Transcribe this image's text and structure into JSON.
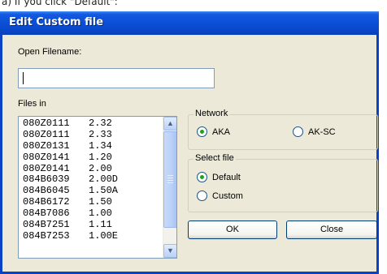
{
  "caption": "a) If you click \"Default\":",
  "window": {
    "title": "Edit Custom file"
  },
  "open_filename": {
    "label": "Open Filename:",
    "value": ""
  },
  "files": {
    "label": "Files in",
    "items": [
      {
        "name": "080Z0111",
        "version": "2.32"
      },
      {
        "name": "080Z0111",
        "version": "2.33"
      },
      {
        "name": "080Z0131",
        "version": "1.34"
      },
      {
        "name": "080Z0141",
        "version": "1.20"
      },
      {
        "name": "080Z0141",
        "version": "2.00"
      },
      {
        "name": "084B6039",
        "version": "2.00D"
      },
      {
        "name": "084B6045",
        "version": "1.50A"
      },
      {
        "name": "084B6172",
        "version": "1.50"
      },
      {
        "name": "084B7086",
        "version": "1.00"
      },
      {
        "name": "084B7251",
        "version": "1.11"
      },
      {
        "name": "084B7253",
        "version": "1.00E"
      }
    ]
  },
  "network": {
    "title": "Network",
    "options": [
      {
        "label": "AKA",
        "selected": true
      },
      {
        "label": "AK-SC",
        "selected": false
      }
    ]
  },
  "select_file": {
    "title": "Select file",
    "options": [
      {
        "label": "Default",
        "selected": true
      },
      {
        "label": "Custom",
        "selected": false
      }
    ]
  },
  "buttons": {
    "ok": "OK",
    "close": "Close"
  },
  "icons": {
    "scroll_up": "chevron-up-icon",
    "scroll_down": "chevron-down-icon"
  },
  "colors": {
    "titlebar": "#0a4fd7",
    "dialog_bg": "#ece9d8",
    "radio_dot": "#21a121"
  }
}
